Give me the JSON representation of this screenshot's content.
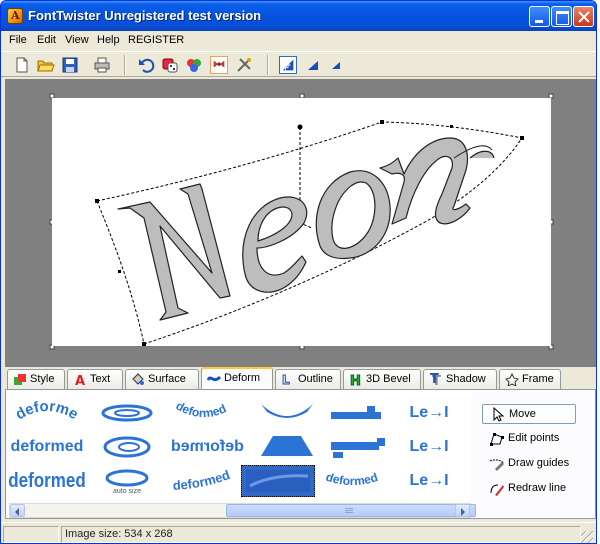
{
  "window": {
    "title": "FontTwister Unregistered test version"
  },
  "menu": {
    "items": [
      "File",
      "Edit",
      "View",
      "Help",
      "REGISTER"
    ]
  },
  "canvas": {
    "art_text": "Neon"
  },
  "tabs": [
    {
      "label": "Style",
      "icon": "style-icon"
    },
    {
      "label": "Text",
      "icon": "text-icon"
    },
    {
      "label": "Surface",
      "icon": "surface-icon"
    },
    {
      "label": "Deform",
      "icon": "deform-icon",
      "active": true
    },
    {
      "label": "Outline",
      "icon": "outline-icon"
    },
    {
      "label": "3D Bevel",
      "icon": "bevel-icon"
    },
    {
      "label": "Shadow",
      "icon": "shadow-icon"
    },
    {
      "label": "Frame",
      "icon": "frame-icon"
    }
  ],
  "deform_presets": {
    "word": "deformed",
    "auto_size_caption": "auto size",
    "mirror_caption": "Le→Ɩ"
  },
  "tools": {
    "move": "Move",
    "edit_points": "Edit points",
    "draw_guides": "Draw guides",
    "redraw_line": "Redraw line"
  },
  "status": {
    "image_size": "Image size: 534 x 268"
  },
  "colors": {
    "titlebar": "#0553e0",
    "accent_blue": "#2b74d6",
    "selection": "#316ac5",
    "workspace": "#808080"
  }
}
